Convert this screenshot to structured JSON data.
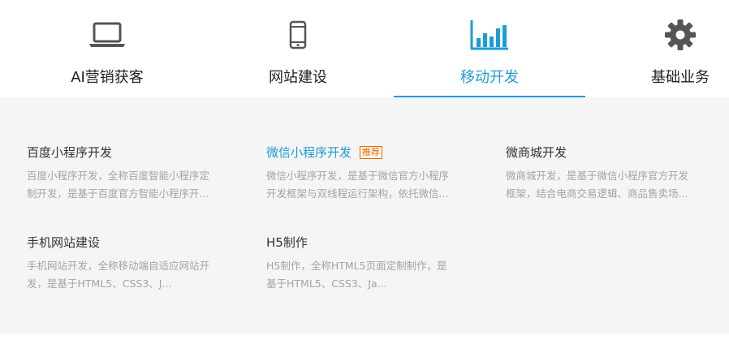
{
  "colors": {
    "accent": "#1e9bd7",
    "badge": "#e06a00",
    "text": "#333333",
    "muted": "#a4a4a4",
    "panel_bg": "#f5f5f5"
  },
  "tabs": [
    {
      "label": "AI营销获客",
      "icon": "laptop-icon",
      "active": false
    },
    {
      "label": "网站建设",
      "icon": "mobile-phone-icon",
      "active": false
    },
    {
      "label": "移动开发",
      "icon": "bar-chart-icon",
      "active": true
    },
    {
      "label": "基础业务",
      "icon": "gear-icon",
      "active": false
    }
  ],
  "cards": [
    {
      "title": "百度小程序开发",
      "desc_line1": "百度小程序开发，全称百度智能小程序定",
      "desc_line2": "制开发，是基于百度官方智能小程序开..."
    },
    {
      "title": "微信小程序开发",
      "badge": "推荐",
      "desc_line1": "微信小程序开发，是基于微信官方小程序",
      "desc_line2": "开发框架与双线程运行架构，依托微信..."
    },
    {
      "title": "微商城开发",
      "desc_line1": "微商城开发，是基于微信小程序官方开发",
      "desc_line2": "框架，结合电商交易逻辑、商品售卖场..."
    },
    {
      "title": "手机网站建设",
      "desc_line1": "手机网站开发，全称移动端自适应网站开",
      "desc_line2": "发，是基于HTML5、CSS3、J..."
    },
    {
      "title": "H5制作",
      "desc_line1": "H5制作，全称HTML5页面定制制作，是",
      "desc_line2": "基于HTML5、CSS3、Ja..."
    }
  ]
}
